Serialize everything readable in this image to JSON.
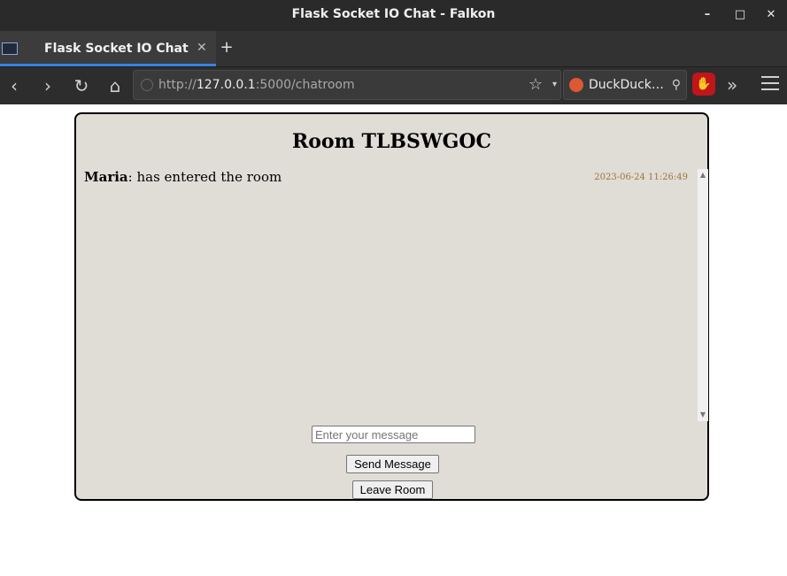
{
  "window": {
    "title": "Flask Socket IO Chat - Falkon"
  },
  "tabs": [
    {
      "label": "Flask Socket IO Chat",
      "active": true
    }
  ],
  "navbar": {
    "url_scheme": "http://",
    "url_host": "127.0.0.1",
    "url_rest": ":5000/chatroom",
    "search_engine": "DuckDuck…"
  },
  "page": {
    "room_title": "Room TLBSWGOC",
    "messages": [
      {
        "user": "Maria",
        "text": ": has entered the room",
        "timestamp": "2023-06-24 11:26:49"
      }
    ],
    "input_placeholder": "Enter your message",
    "send_label": "Send Message",
    "leave_label": "Leave Room"
  },
  "colors": {
    "chat_background": "#e0ddd7",
    "timestamp": "#9b7633",
    "tab_accent": "#3584e4",
    "ublock": "#c0161b"
  }
}
